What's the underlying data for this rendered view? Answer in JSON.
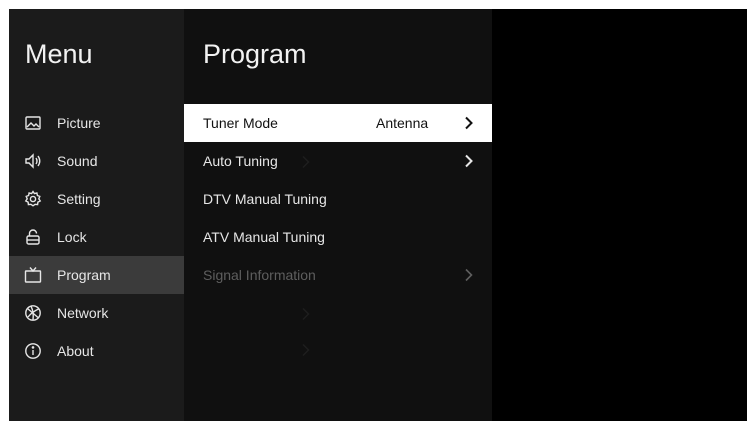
{
  "menu": {
    "title": "Menu",
    "items": [
      {
        "label": "Picture",
        "icon": "picture-icon"
      },
      {
        "label": "Sound",
        "icon": "sound-icon"
      },
      {
        "label": "Setting",
        "icon": "gear-icon"
      },
      {
        "label": "Lock",
        "icon": "lock-icon"
      },
      {
        "label": "Program",
        "icon": "tv-icon"
      },
      {
        "label": "Network",
        "icon": "network-icon"
      },
      {
        "label": "About",
        "icon": "info-icon"
      }
    ]
  },
  "program": {
    "title": "Program",
    "items": [
      {
        "label": "Tuner Mode",
        "value": "Antenna"
      },
      {
        "label": "Auto Tuning"
      },
      {
        "label": "DTV Manual Tuning"
      },
      {
        "label": "ATV Manual Tuning"
      },
      {
        "label": "Signal Information"
      }
    ]
  },
  "colors": {
    "menu_bg": "#1b1b1b",
    "program_bg": "#101010",
    "active_menu_bg": "#3b3b3b",
    "selected_bg": "#ffffff"
  }
}
